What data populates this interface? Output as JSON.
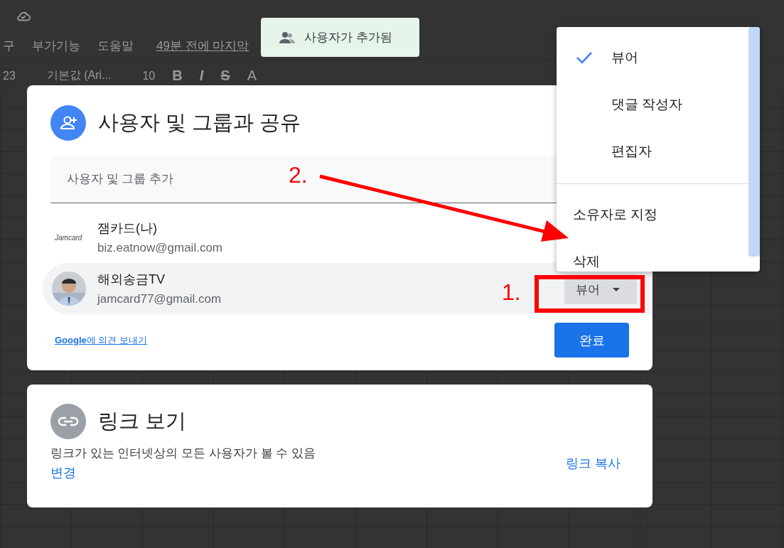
{
  "background": {
    "menu_items": [
      "구",
      "부가기능",
      "도움말"
    ],
    "last_edit": "49분 전에 마지막",
    "toolbar": {
      "zoom": "23",
      "font": "기본값 (Ari...",
      "size": "10",
      "format_buttons": [
        {
          "label": "B",
          "kind": "bold"
        },
        {
          "label": "I",
          "kind": "italic"
        },
        {
          "label": "S",
          "kind": "strike"
        },
        {
          "label": "A",
          "kind": "color"
        }
      ]
    }
  },
  "toast": {
    "text": "사용자가 추가됨"
  },
  "share_dialog": {
    "title": "사용자 및 그룹과 공유",
    "add_field": {
      "placeholder": "사용자 및 그룹 추가"
    },
    "people": [
      {
        "kind": "logo",
        "logo_text": "Jamcard",
        "name": "잼카드(나)",
        "email": "biz.eatnow@gmail.com",
        "highlighted": false
      },
      {
        "name": "해외송금TV",
        "email": "jamcard77@gmail.com",
        "highlighted": true,
        "role": "뷰어"
      }
    ],
    "feedback_link": "**Google**에 의견 보내기",
    "done_button": "완료"
  },
  "role_menu": {
    "items": [
      {
        "kind": "role",
        "label": "뷰어",
        "selected": true
      },
      {
        "kind": "role",
        "label": "댓글 작성자",
        "selected": false
      },
      {
        "kind": "role",
        "label": "편집자",
        "selected": false
      },
      {
        "kind": "action",
        "label": "소유자로 지정"
      },
      {
        "kind": "action",
        "label": "삭제"
      }
    ]
  },
  "link_dialog": {
    "title": "링크 보기",
    "description": "링크가 있는 인터넷상의 모든 사용자가 볼 수 있음",
    "change_link": "변경",
    "copy_link": "링크 복사"
  },
  "annotations": [
    {
      "label": "1.",
      "kind": "box"
    },
    {
      "label": "2.",
      "kind": "arrow"
    }
  ]
}
